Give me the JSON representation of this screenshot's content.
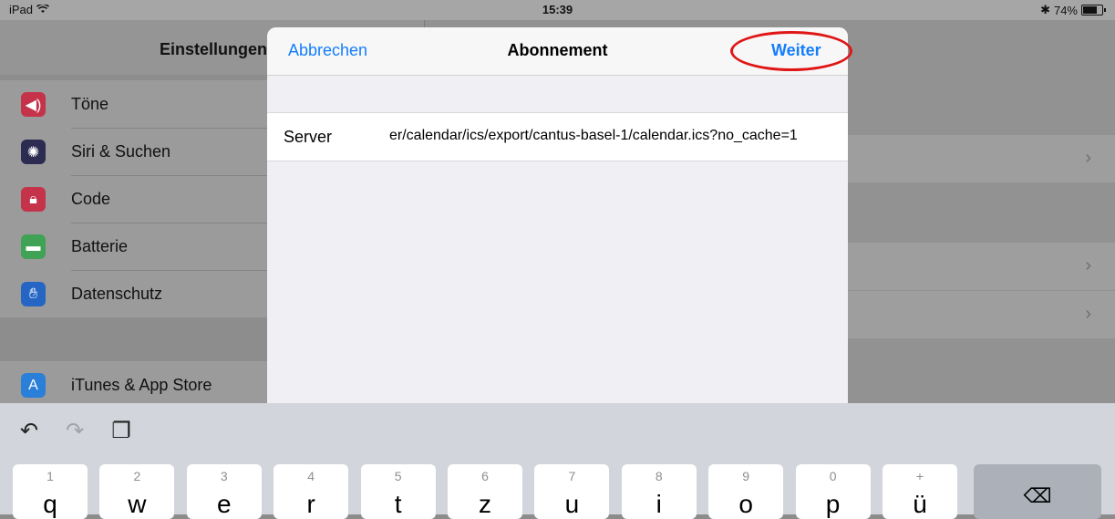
{
  "status_bar": {
    "device": "iPad",
    "wifi_icon": "wifi-icon",
    "time": "15:39",
    "bluetooth_icon": "bluetooth-icon",
    "battery": "74%",
    "battery_level": 0.74
  },
  "settings": {
    "title": "Einstellungen",
    "group1": [
      {
        "label": "Töne",
        "icon": "speaker-icon",
        "color": "#e8334a"
      },
      {
        "label": "Siri & Suchen",
        "icon": "siri-icon",
        "color": "#2b2b5e"
      },
      {
        "label": "Code",
        "icon": "lock-icon",
        "color": "#e8334a"
      },
      {
        "label": "Batterie",
        "icon": "battery-icon",
        "color": "#4cd964"
      },
      {
        "label": "Datenschutz",
        "icon": "hand-icon",
        "color": "#1e7cf5"
      }
    ],
    "group2": [
      {
        "label": "iTunes & App Store",
        "icon": "appstore-icon",
        "color": "#1e90ff"
      }
    ]
  },
  "modal": {
    "cancel_label": "Abbrechen",
    "title": "Abonnement",
    "next_label": "Weiter",
    "server_label": "Server",
    "server_value": "er/calendar/ics/export/cantus-basel-1/calendar.ics?no_cache=1"
  },
  "keyboard": {
    "tools": [
      "undo-icon",
      "redo-icon",
      "paste-icon"
    ],
    "keys": [
      {
        "num": "1",
        "ch": "q"
      },
      {
        "num": "2",
        "ch": "w"
      },
      {
        "num": "3",
        "ch": "e"
      },
      {
        "num": "4",
        "ch": "r"
      },
      {
        "num": "5",
        "ch": "t"
      },
      {
        "num": "6",
        "ch": "z"
      },
      {
        "num": "7",
        "ch": "u"
      },
      {
        "num": "8",
        "ch": "i"
      },
      {
        "num": "9",
        "ch": "o"
      },
      {
        "num": "0",
        "ch": "p"
      },
      {
        "num": "+",
        "ch": "ü"
      }
    ],
    "delete_icon": "delete-icon"
  }
}
